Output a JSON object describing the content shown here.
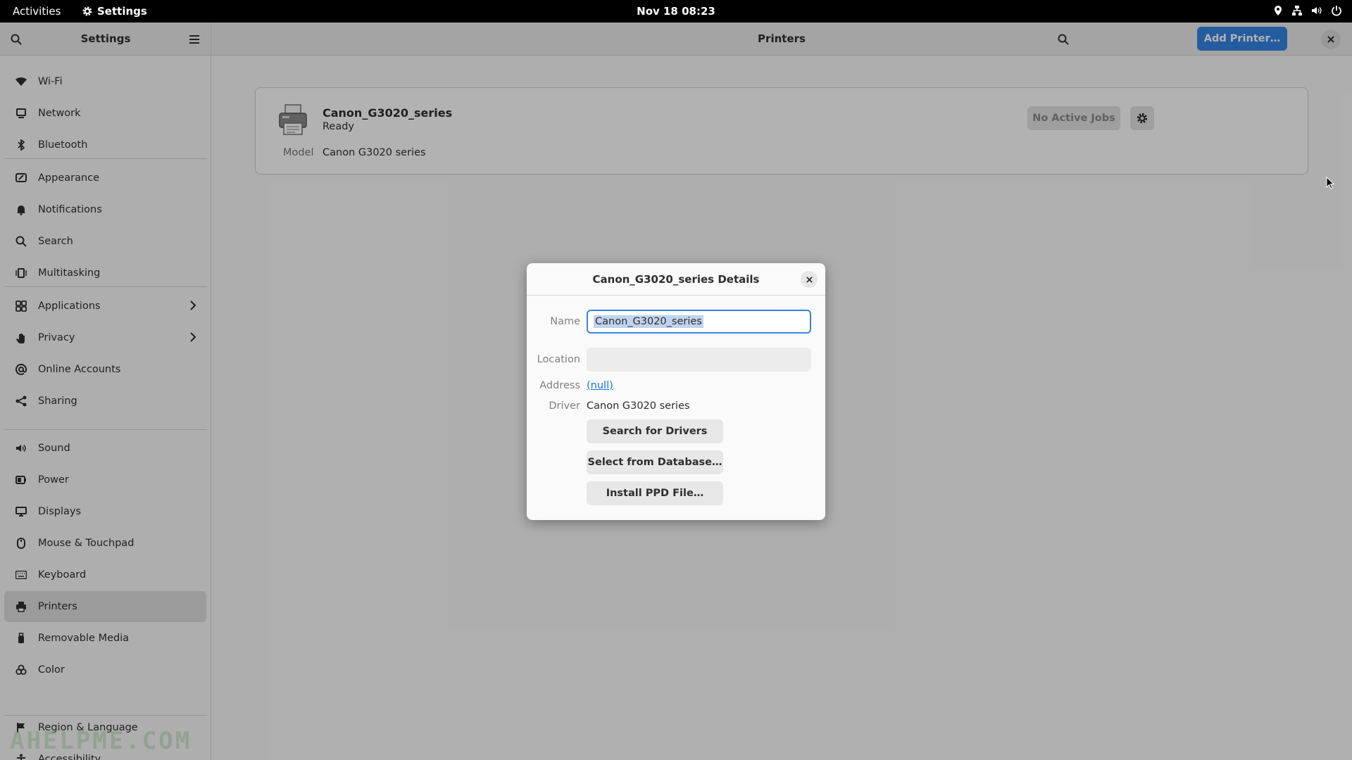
{
  "topbar": {
    "activities": "Activities",
    "app_name": "Settings",
    "clock": "Nov 18  08:23"
  },
  "sidebar": {
    "title": "Settings",
    "items": [
      {
        "label": "Wi-Fi",
        "icon": "wifi-icon"
      },
      {
        "label": "Network",
        "icon": "network-icon"
      },
      {
        "label": "Bluetooth",
        "icon": "bluetooth-icon"
      },
      {
        "label": "Appearance",
        "icon": "appearance-icon"
      },
      {
        "label": "Notifications",
        "icon": "bell-icon"
      },
      {
        "label": "Search",
        "icon": "search-icon"
      },
      {
        "label": "Multitasking",
        "icon": "multitasking-icon"
      },
      {
        "label": "Applications",
        "icon": "apps-grid-icon"
      },
      {
        "label": "Privacy",
        "icon": "hand-icon"
      },
      {
        "label": "Online Accounts",
        "icon": "at-icon"
      },
      {
        "label": "Sharing",
        "icon": "share-icon"
      },
      {
        "label": "Sound",
        "icon": "speaker-icon"
      },
      {
        "label": "Power",
        "icon": "battery-icon"
      },
      {
        "label": "Displays",
        "icon": "monitor-icon"
      },
      {
        "label": "Mouse & Touchpad",
        "icon": "mouse-icon"
      },
      {
        "label": "Keyboard",
        "icon": "keyboard-icon"
      },
      {
        "label": "Printers",
        "icon": "printer-icon"
      },
      {
        "label": "Removable Media",
        "icon": "usb-icon"
      },
      {
        "label": "Color",
        "icon": "palette-icon"
      },
      {
        "label": "Region & Language",
        "icon": "flag-icon"
      },
      {
        "label": "Accessibility",
        "icon": "accessibility-icon"
      }
    ],
    "active": "Printers"
  },
  "main": {
    "title": "Printers",
    "add_printer_label": "Add Printer…",
    "printer": {
      "name": "Canon_G3020_series",
      "status": "Ready",
      "model_label": "Model",
      "model_value": "Canon G3020 series",
      "jobs_label": "No Active Jobs"
    }
  },
  "dialog": {
    "title": "Canon_G3020_series Details",
    "name_label": "Name",
    "name_value": "Canon_G3020_series",
    "location_label": "Location",
    "location_value": "",
    "address_label": "Address",
    "address_value": "(null)",
    "driver_label": "Driver",
    "driver_value": "Canon G3020 series",
    "search_drivers_label": "Search for Drivers",
    "select_database_label": "Select from Database…",
    "install_ppd_label": "Install PPD File…"
  },
  "watermark": "AHELPME.COM",
  "colors": {
    "accent": "#3584e4",
    "topbar": "#000000",
    "link": "#1c71d8"
  }
}
